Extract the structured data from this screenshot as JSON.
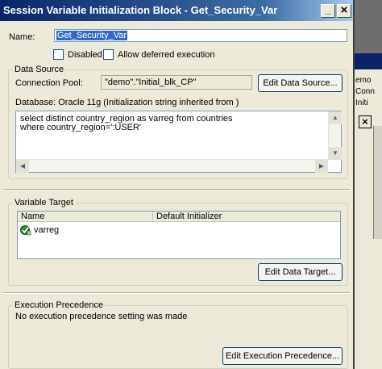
{
  "dialog": {
    "title": "Session Variable Initialization Block - Get_Security_Var",
    "minimize_glyph": "_",
    "close_glyph": "×"
  },
  "name_field": {
    "label": "Name:",
    "value": "Get_Security_Var"
  },
  "options": {
    "disabled_label": "Disabled",
    "disabled_checked": false,
    "deferred_label": "Allow deferred execution",
    "deferred_checked": false
  },
  "data_source": {
    "group_title": "Data Source",
    "connection_pool_label": "Connection Pool:",
    "connection_pool_value": "\"demo\".\"Initial_blk_CP\"",
    "edit_button": "Edit Data Source...",
    "database_line": "Database: Oracle 11g (Initialization string inherited from )",
    "sql_lines": [
      "select distinct country_region as varreg from countries",
      "where country_region=':USER'"
    ]
  },
  "variable_target": {
    "group_title": "Variable Target",
    "columns": [
      "Name",
      "Default Initializer"
    ],
    "rows": [
      {
        "name": "varreg",
        "default": ""
      }
    ],
    "edit_button": "Edit Data Target..."
  },
  "execution_precedence": {
    "group_title": "Execution Precedence",
    "message": "No execution precedence setting was made",
    "edit_button": "Edit Execution Precedence..."
  },
  "background_window": {
    "lines": [
      "emo",
      "Conn",
      "Initi"
    ],
    "close_glyph": "×"
  },
  "colors": {
    "title_start": "#0a246a",
    "title_end": "#a6caf0",
    "dialog_bg": "#ece9d8",
    "selection": "#316ac5",
    "variable_icon": "#2e8b2e"
  }
}
